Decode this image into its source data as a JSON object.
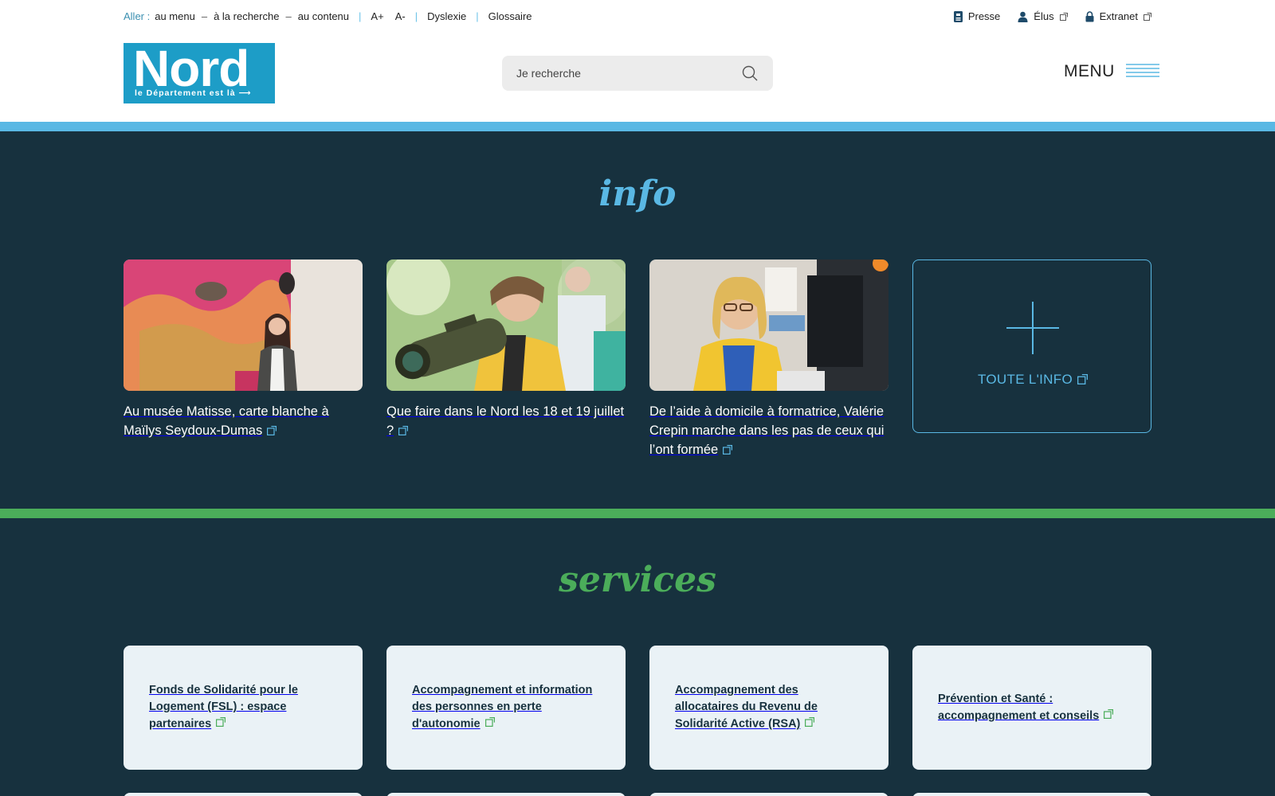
{
  "topbar": {
    "aller": "Aller :",
    "skip_links": [
      "au menu",
      "à la recherche",
      "au contenu"
    ],
    "dash": "–",
    "font_increase": "A+",
    "font_decrease": "A-",
    "dyslexie": "Dyslexie",
    "glossaire": "Glossaire",
    "presse": "Presse",
    "elus": "Élus",
    "extranet": "Extranet"
  },
  "header": {
    "logo_word": "Nord",
    "logo_tagline": "le Département est là ⟶",
    "search_placeholder": "Je recherche",
    "menu_label": "MENU"
  },
  "info": {
    "title": "info",
    "cards": [
      {
        "caption": "Au musée Matisse, carte blanche à Maïlys Seydoux-Dumas"
      },
      {
        "caption": "Que faire dans le Nord les 18 et 19 juillet ?"
      },
      {
        "caption": "De l’aide à domicile à formatrice, Valérie Crepin marche dans les pas de ceux qui l’ont formée"
      }
    ],
    "more_label": "TOUTE L'INFO"
  },
  "services": {
    "title": "services",
    "cards": [
      {
        "label": "Fonds de Solidarité pour le Logement (FSL) : espace partenaires"
      },
      {
        "label": "Accompagnement et information des personnes en perte d'autonomie"
      },
      {
        "label": "Accompagnement des allocataires du Revenu de Solidarité Active (RSA)"
      },
      {
        "label": "Prévention et Santé : accompagnement et conseils"
      }
    ]
  },
  "colors": {
    "brand_blue": "#1d9dc7",
    "accent_blue": "#5ab8e4",
    "accent_green": "#4bad5a",
    "dark_bg": "#17313e",
    "service_card_bg": "#eaf2f6"
  }
}
